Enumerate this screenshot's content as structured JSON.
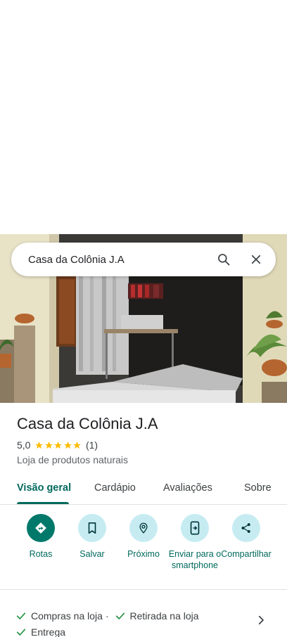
{
  "search": {
    "query": "Casa da Colônia J.A"
  },
  "place": {
    "name": "Casa da Colônia J.A",
    "rating": "5,0",
    "stars": 5,
    "review_count": "(1)",
    "category": "Loja de produtos naturais"
  },
  "tabs": [
    {
      "label": "Visão geral",
      "active": true
    },
    {
      "label": "Cardápio",
      "active": false
    },
    {
      "label": "Avaliações",
      "active": false
    },
    {
      "label": "Sobre",
      "active": false
    }
  ],
  "actions": [
    {
      "label": "Rotas",
      "icon": "directions-icon"
    },
    {
      "label": "Salvar",
      "icon": "bookmark-icon"
    },
    {
      "label": "Próximo",
      "icon": "nearby-icon"
    },
    {
      "label": "Enviar para o smartphone",
      "icon": "send-to-phone-icon"
    },
    {
      "label": "Compartilhar",
      "icon": "share-icon"
    }
  ],
  "services": [
    {
      "label": "Compras na loja",
      "separator": "·"
    },
    {
      "label": "Retirada na loja",
      "separator": ""
    },
    {
      "label": "Entrega",
      "separator": ""
    }
  ],
  "colors": {
    "accent": "#00695c",
    "primary_button": "#00796b",
    "action_circle": "#c6ecf2",
    "star": "#fbbc04"
  }
}
